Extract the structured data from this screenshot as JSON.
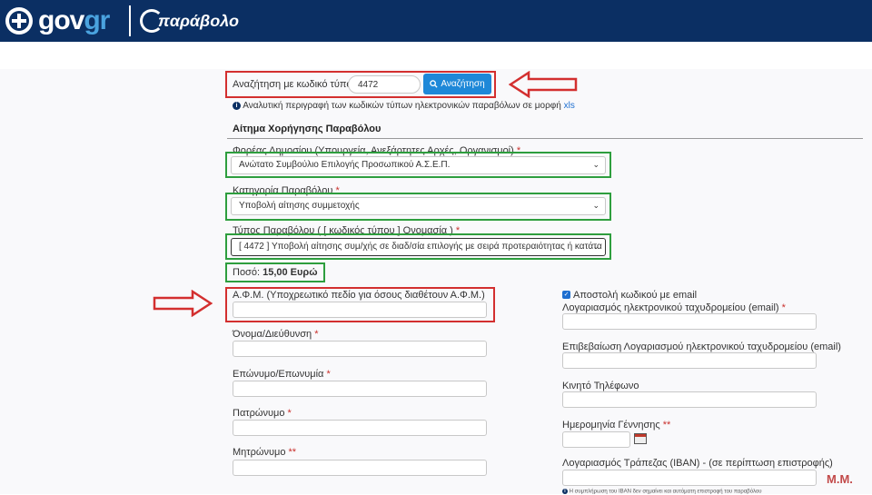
{
  "header": {
    "brand_gov": "gov",
    "brand_gr": "gr",
    "brand_app": "παράβολο"
  },
  "search": {
    "label": "Αναζήτηση με κωδικό τύπου",
    "value": "4472",
    "button": "Αναζήτηση",
    "description": "Αναλυτική περιγραφή των κωδικών τύπων ηλεκτρονικών παραβόλων σε μορφή",
    "xls_link": "xls"
  },
  "form": {
    "title": "Αίτημα Χορήγησης Παραβόλου",
    "agency_label": "Φορέας Δημοσίου (Υπουργεία, Ανεξάρτητες Αρχές, Οργανισμοί)",
    "agency_value": "Ανώτατο Συμβούλιο Επιλογής Προσωπικού Α.Σ.Ε.Π.",
    "category_label": "Κατηγορία Παραβόλου",
    "category_value": "Υποβολή αίτησης συμμετοχής",
    "type_label": "Τύπος Παραβόλου ( [ κωδικός τύπου ] Ονομασία )",
    "type_value": "[ 4472 ] Υποβολή αίτησης συμ/χής σε διαδ/σία επιλογής με σειρά προτεραιότητας ή κατάτα",
    "amount_label": "Ποσό:",
    "amount_value": "15,00 Ευρώ",
    "required_mark": "*",
    "double_required_mark": "**"
  },
  "left_fields": [
    {
      "label": "Α.Φ.Μ. (Υποχρεωτικό πεδίο για όσους διαθέτουν Α.Φ.Μ.)",
      "req": ""
    },
    {
      "label": "Όνομα/Διεύθυνση",
      "req": "*"
    },
    {
      "label": "Επώνυμο/Επωνυμία",
      "req": "*"
    },
    {
      "label": "Πατρώνυμο",
      "req": "*"
    },
    {
      "label": "Μητρώνυμο",
      "req": "**"
    }
  ],
  "right_fields": {
    "send_email_label": "Αποστολή κωδικού με email",
    "email_label": "Λογαριασμός ηλεκτρονικού ταχυδρομείου (email)",
    "email_confirm_label": "Επιβεβαίωση Λογαριασμού ηλεκτρονικού ταχυδρομείου (email)",
    "mobile_label": "Κινητό Τηλέφωνο",
    "dob_label": "Ημερομηνία Γέννησης",
    "iban_label": "Λογαριασμός Τράπεζας (IBAN) - (σε περίπτωση επιστροφής)",
    "iban_note": "Η συμπλήρωση του IBAN δεν σημαίνει και αυτόματη επιστροφή του παραβόλου"
  },
  "watermark": "Μ.Μ.",
  "colors": {
    "header_bg": "#0b2f63",
    "button_bg": "#1e88d8",
    "highlight_red": "#d32f2f",
    "highlight_green": "#2e9e3e"
  }
}
